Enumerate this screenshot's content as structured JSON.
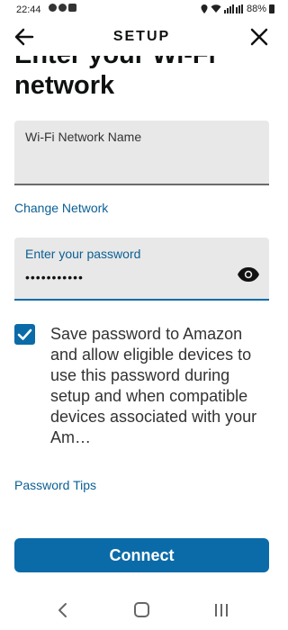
{
  "status_bar": {
    "time": "22:44",
    "battery": "88%"
  },
  "header": {
    "title": "SETUP"
  },
  "heading": {
    "line1": "Enter your Wi-Fi",
    "line2": "network"
  },
  "network_field": {
    "label": "Wi-Fi Network Name"
  },
  "change_network_link": "Change Network",
  "password_field": {
    "label": "Enter your password",
    "value": "•••••••••••"
  },
  "save_password": {
    "checked": true,
    "text": "Save password to Amazon and allow eligible devices to use this password during setup and when compatible devices associated with your Am…"
  },
  "password_tips_link": "Password Tips",
  "connect_button": "Connect",
  "colors": {
    "accent": "#0b6ba8",
    "link": "#0b5f95"
  }
}
